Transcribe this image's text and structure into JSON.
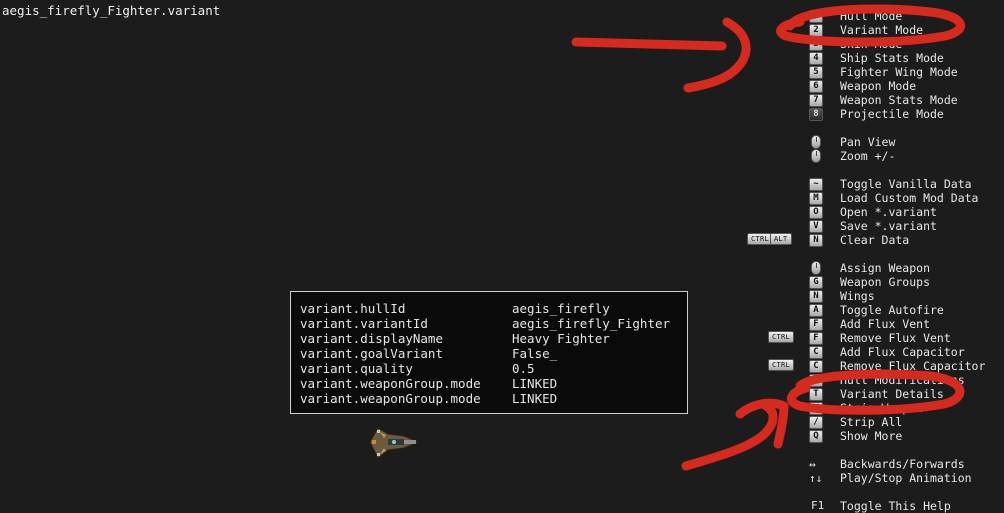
{
  "file_title": "aegis_firefly_Fighter.variant",
  "details": [
    {
      "key": "variant.hullId",
      "value": "aegis_firefly"
    },
    {
      "key": "variant.variantId",
      "value": "aegis_firefly_Fighter"
    },
    {
      "key": "variant.displayName",
      "value": "Heavy Fighter"
    },
    {
      "key": "variant.goalVariant",
      "value": "False_"
    },
    {
      "key": "variant.quality",
      "value": "0.5"
    },
    {
      "key": "variant.weaponGroup.mode",
      "value": "LINKED"
    },
    {
      "key": "variant.weaponGroup.mode",
      "value": "LINKED"
    }
  ],
  "help": {
    "modes": [
      {
        "key": "1",
        "label": "Hull Mode"
      },
      {
        "key": "2",
        "label": "Variant Mode"
      },
      {
        "key": "3",
        "label": "Skin Mode"
      },
      {
        "key": "4",
        "label": "Ship Stats Mode"
      },
      {
        "key": "5",
        "label": "Fighter Wing Mode"
      },
      {
        "key": "6",
        "label": "Weapon Mode"
      },
      {
        "key": "7",
        "label": "Weapon Stats Mode"
      },
      {
        "key": "8",
        "label": "Projectile Mode"
      }
    ],
    "view": [
      {
        "icon": "mouse-icon",
        "label": "Pan View"
      },
      {
        "icon": "scroll-wheel-icon",
        "label": "Zoom +/-"
      }
    ],
    "file": [
      {
        "key": "~",
        "label": "Toggle Vanilla Data"
      },
      {
        "key": "M",
        "label": "Load Custom Mod Data"
      },
      {
        "key": "O",
        "label": "Open *.variant"
      },
      {
        "key": "V",
        "label": "Save *.variant"
      },
      {
        "key": "N",
        "label": "Clear Data",
        "modifiers": [
          "CTRL",
          "ALT"
        ]
      }
    ],
    "edit": [
      {
        "key": "",
        "label": "Assign Weapon",
        "icon": "mouse-icon"
      },
      {
        "key": "G",
        "label": "Weapon Groups"
      },
      {
        "key": "N",
        "label": "Wings"
      },
      {
        "key": "A",
        "label": "Toggle Autofire"
      },
      {
        "key": "F",
        "label": "Add Flux Vent"
      },
      {
        "key": "F",
        "label": "Remove Flux Vent",
        "modifiers": [
          "CTRL"
        ]
      },
      {
        "key": "C",
        "label": "Add Flux Capacitor"
      },
      {
        "key": "C",
        "label": "Remove Flux Capacitor",
        "modifiers": [
          "CTRL"
        ]
      },
      {
        "key": "H",
        "label": "Hull Modifications"
      },
      {
        "key": "T",
        "label": "Variant Details"
      },
      {
        "key": "W",
        "label": "Strip Weapon"
      },
      {
        "key": "/",
        "label": "Strip All"
      },
      {
        "key": "Q",
        "label": "Show More"
      }
    ],
    "misc": [
      {
        "key": "↔",
        "label": "Backwards/Forwards"
      },
      {
        "key": "↑↓",
        "label": "Play/Stop Animation"
      },
      {
        "key": "F1",
        "label": "Toggle This Help"
      }
    ]
  },
  "colors": {
    "background": "#1c1c1c",
    "annotation": "#d62a1e",
    "panel_border": "#cfcfcf"
  }
}
